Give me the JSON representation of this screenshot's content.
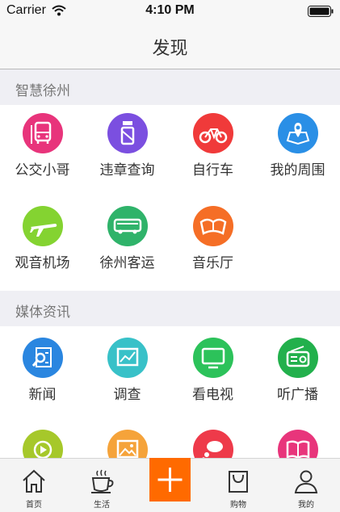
{
  "status_bar": {
    "carrier": "Carrier",
    "time": "4:10 PM"
  },
  "nav": {
    "title": "发现"
  },
  "sections": [
    {
      "title": "智慧徐州",
      "items": [
        {
          "label": "公交小哥",
          "icon": "bus-icon",
          "color": "#e8347b"
        },
        {
          "label": "违章查询",
          "icon": "traffic-officer-icon",
          "color": "#7b4fe0"
        },
        {
          "label": "自行车",
          "icon": "bicycle-icon",
          "color": "#f03a3a"
        },
        {
          "label": "我的周围",
          "icon": "location-map-icon",
          "color": "#2a8fe6"
        },
        {
          "label": "观音机场",
          "icon": "airplane-icon",
          "color": "#84d331"
        },
        {
          "label": "徐州客运",
          "icon": "coach-bus-icon",
          "color": "#2fb36a"
        },
        {
          "label": "音乐厅",
          "icon": "concert-hall-icon",
          "color": "#f56e26"
        }
      ]
    },
    {
      "title": "媒体资讯",
      "items": [
        {
          "label": "新闻",
          "icon": "news-search-icon",
          "color": "#2a86e0"
        },
        {
          "label": "调查",
          "icon": "survey-chart-icon",
          "color": "#38c1c8"
        },
        {
          "label": "看电视",
          "icon": "tv-icon",
          "color": "#2cc25a"
        },
        {
          "label": "听广播",
          "icon": "radio-icon",
          "color": "#22b04c"
        },
        {
          "label": "",
          "icon": "video-play-icon",
          "color": "#a6c82a"
        },
        {
          "label": "",
          "icon": "picture-icon",
          "color": "#f5a33a"
        },
        {
          "label": "",
          "icon": "chat-bubble-icon",
          "color": "#ee3a4a"
        },
        {
          "label": "",
          "icon": "book-icon",
          "color": "#e8357b"
        }
      ]
    }
  ],
  "tab_bar": {
    "items": [
      {
        "label": "首页",
        "icon": "home-icon"
      },
      {
        "label": "生活",
        "icon": "coffee-cup-icon"
      },
      {
        "label": "",
        "icon": "plus-icon"
      },
      {
        "label": "购物",
        "icon": "shopping-bag-icon"
      },
      {
        "label": "我的",
        "icon": "user-icon"
      }
    ],
    "accent": "#ff6a00"
  }
}
